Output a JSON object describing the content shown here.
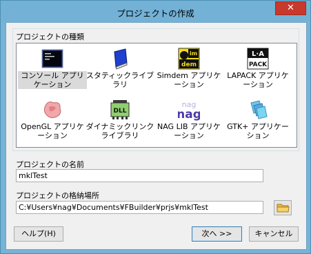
{
  "window": {
    "title": "プロジェクトの作成",
    "close_symbol": "✕"
  },
  "project_types": {
    "label": "プロジェクトの種類",
    "items": [
      {
        "label": "コンソール アプリケーション",
        "icon": "console-icon",
        "selected": true
      },
      {
        "label": "スタティックライブラリ",
        "icon": "book-icon"
      },
      {
        "label": "Simdem アプリケーション",
        "icon": "simdem-icon"
      },
      {
        "label": "LAPACK アプリケーション",
        "icon": "lapack-icon"
      },
      {
        "label": "OpenGL アプリケーション",
        "icon": "opengl-icon"
      },
      {
        "label": "ダイナミックリンクライブラリ",
        "icon": "dll-icon"
      },
      {
        "label": "NAG LIB アプリケーション",
        "icon": "nag-icon"
      },
      {
        "label": "GTK+ アプリケーション",
        "icon": "gtk-icon"
      }
    ]
  },
  "project_name": {
    "label": "プロジェクトの名前",
    "value": "mklTest"
  },
  "project_location": {
    "label": "プロジェクトの格納場所",
    "value": "C:¥Users¥nag¥Documents¥FBuilder¥prjs¥mklTest"
  },
  "buttons": {
    "help": "ヘルプ(H)",
    "next": "次へ >>",
    "cancel": "キャンセル"
  },
  "colors": {
    "titlebar": "#73b1d6",
    "close": "#c7392c",
    "selection": "#dadada"
  }
}
